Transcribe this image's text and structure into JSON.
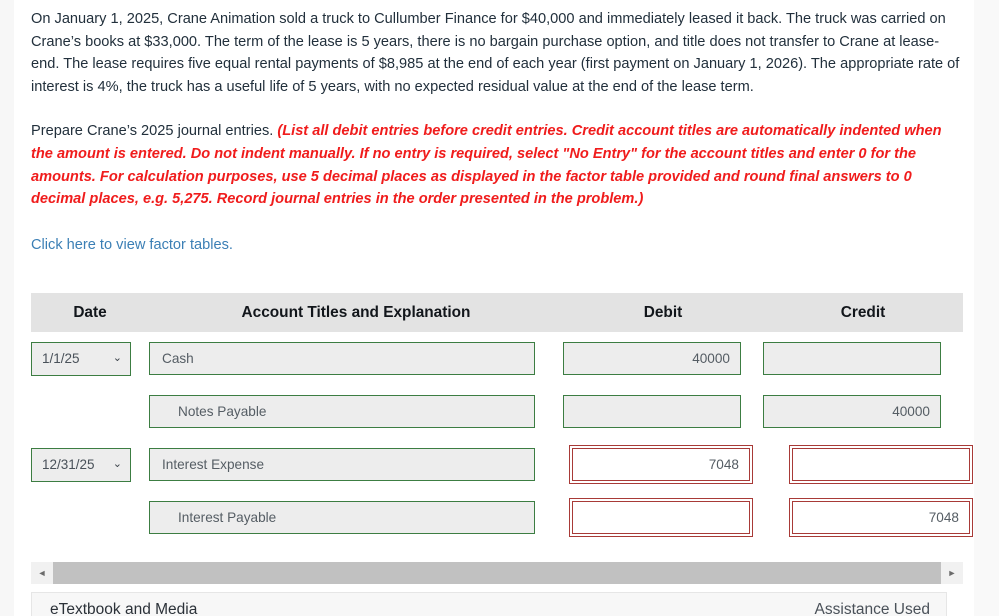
{
  "problem": {
    "narrative": "On January 1, 2025, Crane Animation sold a truck to Cullumber Finance for $40,000 and immediately leased it back. The truck was carried on Crane’s books at $33,000. The term of the lease is 5 years, there is no bargain purchase option, and title does not transfer to Crane at lease-end. The lease requires five equal rental payments of $8,985 at the end of each year (first payment on January 1, 2026). The appropriate rate of interest is 4%, the truck has a useful life of 5 years, with no expected residual value at the end of the lease term.",
    "prompt_lead": "Prepare Crane’s 2025 journal entries. ",
    "prompt_note": "(List all debit entries before credit entries. Credit account titles are automatically indented when the amount is entered. Do not indent manually. If no entry is required, select \"No Entry\" for the account titles and enter 0 for the amounts. For calculation purposes, use 5 decimal places as displayed in the factor table provided and round final answers to 0 decimal places, e.g. 5,275. Record journal entries in the order presented in the problem.)",
    "factor_link": "Click here to view factor tables."
  },
  "journal": {
    "headers": {
      "date": "Date",
      "account": "Account Titles and Explanation",
      "debit": "Debit",
      "credit": "Credit"
    },
    "rows": [
      {
        "date": "1/1/25",
        "has_date": true,
        "account": "Cash",
        "indented": false,
        "debit": "40000",
        "credit": "",
        "debit_flagged": false,
        "credit_flagged": false
      },
      {
        "date": "",
        "has_date": false,
        "account": "Notes Payable",
        "indented": true,
        "debit": "",
        "credit": "40000",
        "debit_flagged": false,
        "credit_flagged": false
      },
      {
        "date": "12/31/25",
        "has_date": true,
        "account": "Interest Expense",
        "indented": false,
        "debit": "7048",
        "credit": "",
        "debit_flagged": true,
        "credit_flagged": true
      },
      {
        "date": "",
        "has_date": false,
        "account": "Interest Payable",
        "indented": true,
        "debit": "",
        "credit": "7048",
        "debit_flagged": true,
        "credit_flagged": true
      }
    ]
  },
  "scrollbar": {
    "left_arrow": "◄",
    "right_arrow": "►"
  },
  "footer": {
    "etextbook_label": "eTextbook and Media",
    "assistance_label": "Assistance Used"
  },
  "colors": {
    "note_red": "#f01c1c",
    "link_blue": "#3b7fb5",
    "field_green": "#3c7d42",
    "error_red": "#a83a37",
    "header_gray": "#e3e3e3"
  }
}
